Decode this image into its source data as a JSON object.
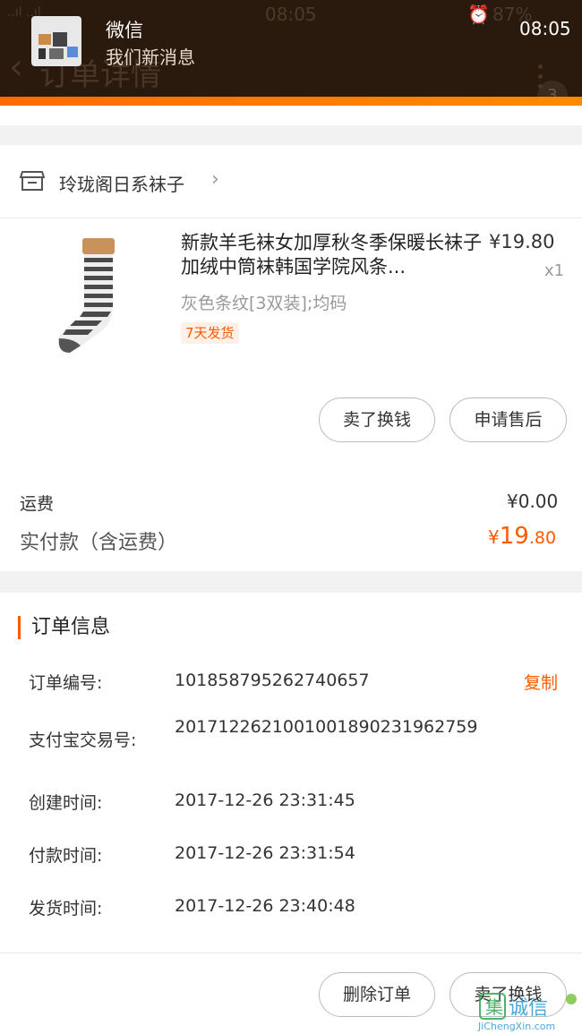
{
  "status_bar": {
    "signal": "..ıl ..ıl",
    "time_center": "08:05",
    "battery": "87%"
  },
  "header": {
    "title": "订单详情",
    "badge_count": "3"
  },
  "notification": {
    "app": "微信",
    "message": "我们新消息",
    "time": "08:05"
  },
  "shop": {
    "name": "玲珑阁日系袜子"
  },
  "product": {
    "title": "新款羊毛袜女加厚秋冬季保暖长袜子加绒中筒袜韩国学院风条...",
    "price": "¥19.80",
    "qty": "x1",
    "spec": "灰色条纹[3双装];均码",
    "tag": "7天发货"
  },
  "order_actions": {
    "sell": "卖了换钱",
    "after_sale": "申请售后"
  },
  "summary": {
    "shipping_label": "运费",
    "shipping_value": "¥0.00",
    "paid_label": "实付款（含运费）",
    "paid_yen": "¥",
    "paid_int": "19",
    "paid_dec": ".80"
  },
  "order_info": {
    "heading": "订单信息",
    "copy": "复制",
    "rows": [
      {
        "label": "订单编号:",
        "value": "101858795262740657"
      },
      {
        "label": "支付宝交易号:",
        "value": "2017122621001001890231962759"
      },
      {
        "label": "创建时间:",
        "value": "2017-12-26 23:31:45"
      },
      {
        "label": "付款时间:",
        "value": "2017-12-26 23:31:54"
      },
      {
        "label": "发货时间:",
        "value": "2017-12-26 23:40:48"
      }
    ]
  },
  "footer": {
    "delete": "删除订单",
    "sell": "卖了换钱"
  },
  "watermark": {
    "text": "JiChengXin.com"
  },
  "colors": {
    "accent": "#ff5a00",
    "header_bg": "#2a1a0e"
  }
}
